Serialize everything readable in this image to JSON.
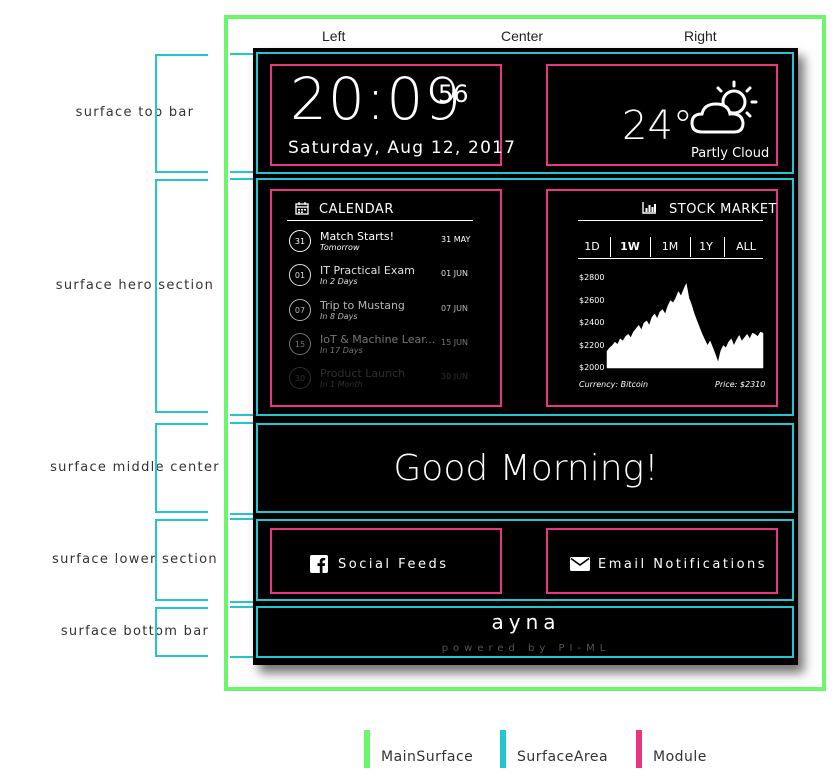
{
  "columns": {
    "left": "Left",
    "center": "Center",
    "right": "Right"
  },
  "side_labels": {
    "top_bar": "surface top bar",
    "hero": "surface hero section",
    "middle": "surface middle center",
    "lower": "surface lower section",
    "bottom": "surface bottom bar"
  },
  "clock": {
    "time": "20:09",
    "seconds": "56",
    "date": "Saturday, Aug 12, 2017"
  },
  "weather": {
    "temperature": "24°",
    "condition": "Partly Cloud",
    "icon": "partly-cloudy-icon"
  },
  "calendar": {
    "title": "CALENDAR",
    "icon": "calendar-icon",
    "events": [
      {
        "day": "31",
        "title": "Match Starts!",
        "sub": "Tomorrow",
        "date": "31 MAY"
      },
      {
        "day": "01",
        "title": "IT Practical Exam",
        "sub": "In 2 Days",
        "date": "01 JUN"
      },
      {
        "day": "07",
        "title": "Trip to Mustang",
        "sub": "In 8 Days",
        "date": "07 JUN"
      },
      {
        "day": "15",
        "title": "IoT & Machine Lear...",
        "sub": "In 17 Days",
        "date": "15 JUN"
      },
      {
        "day": "30",
        "title": "Product Launch",
        "sub": "In 1 Month",
        "date": "30 JUN"
      }
    ]
  },
  "stock": {
    "title": "STOCK MARKET",
    "icon": "bar-chart-icon",
    "ranges": [
      "1D",
      "1W",
      "1M",
      "1Y",
      "ALL"
    ],
    "selected_range": "1W",
    "y_ticks": [
      "$2800",
      "$2600",
      "$2400",
      "$2200",
      "$2000"
    ],
    "currency_label": "Currency: Bitcoin",
    "price_label": "Price: $2310"
  },
  "chart_data": {
    "type": "area",
    "title": "",
    "xlabel": "",
    "ylabel": "",
    "ylim": [
      2000,
      2800
    ],
    "y_ticks": [
      2000,
      2200,
      2400,
      2600,
      2800
    ],
    "values": [
      2150,
      2180,
      2200,
      2230,
      2210,
      2260,
      2240,
      2280,
      2300,
      2270,
      2320,
      2350,
      2380,
      2340,
      2400,
      2420,
      2380,
      2450,
      2480,
      2440,
      2500,
      2520,
      2480,
      2550,
      2600,
      2580,
      2620,
      2680,
      2640,
      2700,
      2750,
      2620,
      2560,
      2480,
      2420,
      2360,
      2300,
      2250,
      2200,
      2240,
      2180,
      2120,
      2050,
      2150,
      2200,
      2180,
      2230,
      2260,
      2200,
      2250,
      2290,
      2240,
      2270,
      2300,
      2260,
      2310,
      2300,
      2280,
      2320,
      2310
    ]
  },
  "middle": {
    "greeting": "Good Morning!"
  },
  "lower": {
    "social": {
      "label": "Social Feeds",
      "icon": "facebook-icon"
    },
    "email": {
      "label": "Email Notifications",
      "icon": "envelope-icon"
    }
  },
  "bottom": {
    "brand": "ayna",
    "powered": "powered by PI-ML"
  },
  "legend": [
    {
      "label": "MainSurface",
      "color": "#6cf66c"
    },
    {
      "label": "SurfaceArea",
      "color": "#22c6d0"
    },
    {
      "label": "Module",
      "color": "#e8377e"
    }
  ]
}
